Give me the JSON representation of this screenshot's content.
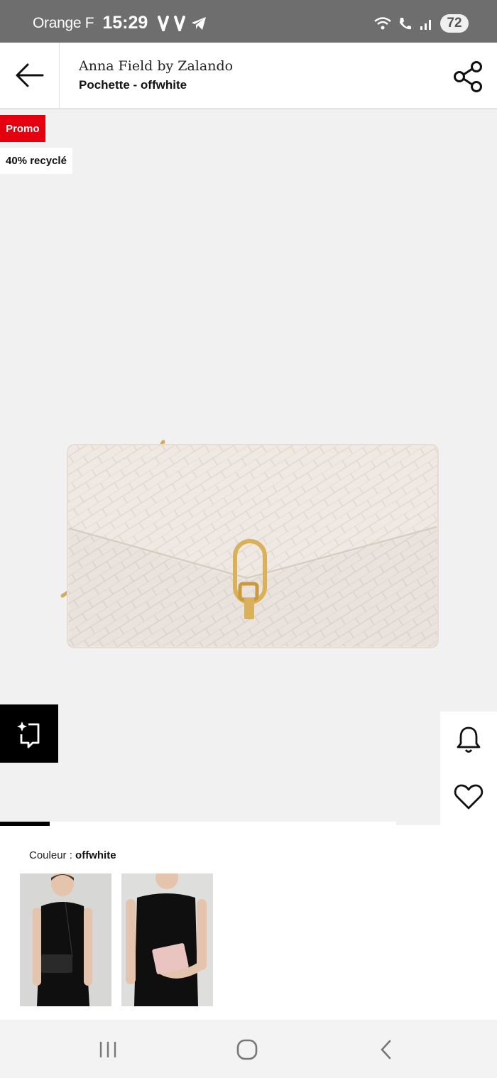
{
  "status_bar": {
    "carrier": "Orange F",
    "time": "15:29",
    "battery": "72"
  },
  "header": {
    "brand": "Anna Field by Zalando",
    "product_name": "Pochette - offwhite"
  },
  "gallery": {
    "badges": [
      "Promo",
      "40% recyclé"
    ],
    "image_progress": 0.125
  },
  "color_section": {
    "label": "Couleur : ",
    "value": "offwhite"
  },
  "colors": {
    "promo": "#e4000f",
    "gallery_bg": "#f1f1f1",
    "bag": "#f0e9e3",
    "gold": "#d8b15a"
  }
}
